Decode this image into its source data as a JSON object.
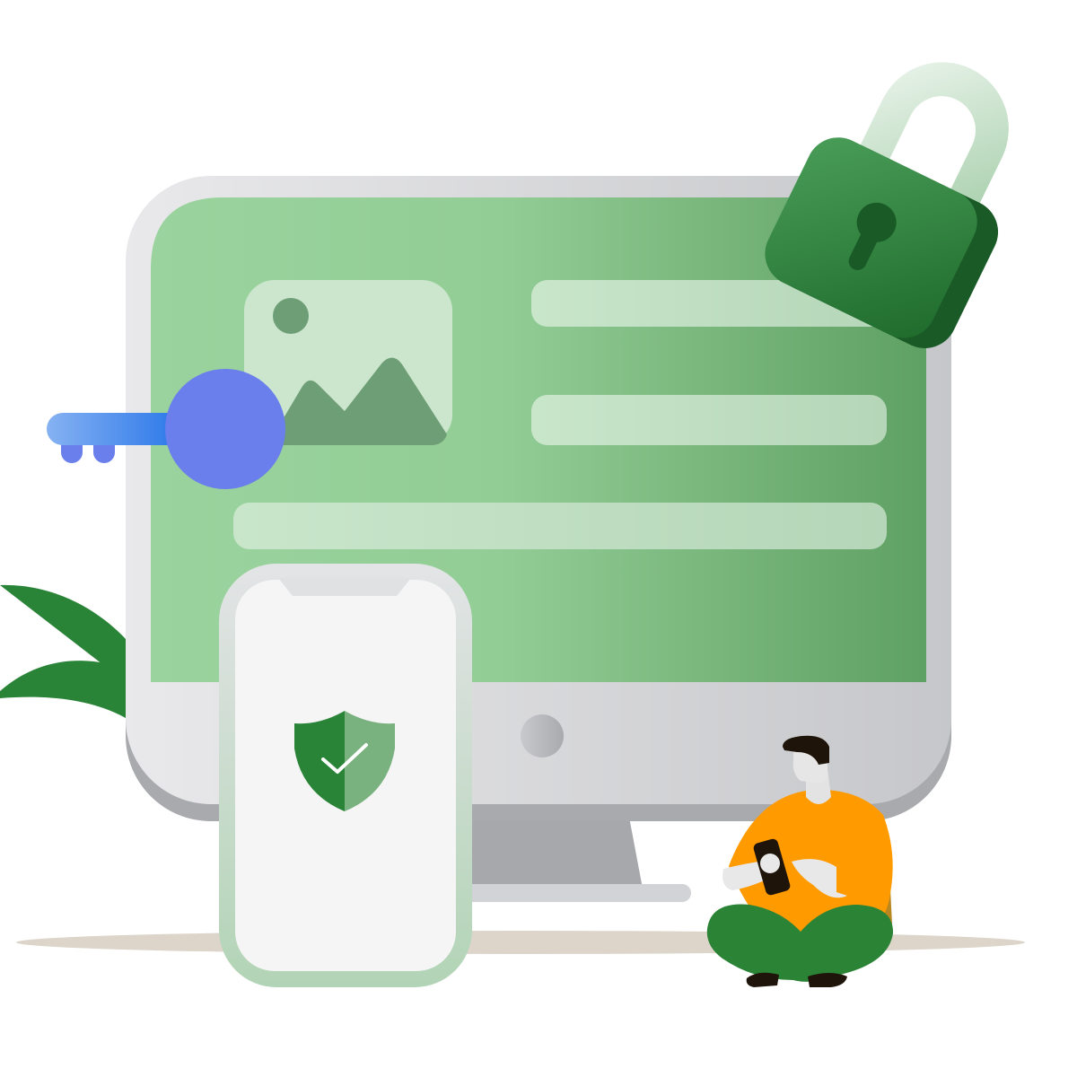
{
  "illustration": {
    "elements": [
      "monitor",
      "image-placeholder-icon",
      "text-placeholder-bars",
      "padlock-icon",
      "key-icon",
      "smartphone",
      "shield-check-icon",
      "person-with-phone",
      "plant-leaves",
      "floor-shadow"
    ]
  },
  "colors": {
    "screen_light": "#9bd39e",
    "screen_dark": "#5fa064",
    "bezel_light": "#e6e6e8",
    "bezel_dark": "#c6c7ca",
    "stand": "#a7a8ab",
    "lock_light": "#3f9650",
    "lock_dark": "#195a26",
    "key_blue": "#6a7fec",
    "shield_dark": "#2a8438",
    "shield_light": "#79b17f",
    "shirt_orange": "#ff9a00",
    "pants_green": "#2b8436",
    "floor_shadow": "#ddd5ca"
  }
}
